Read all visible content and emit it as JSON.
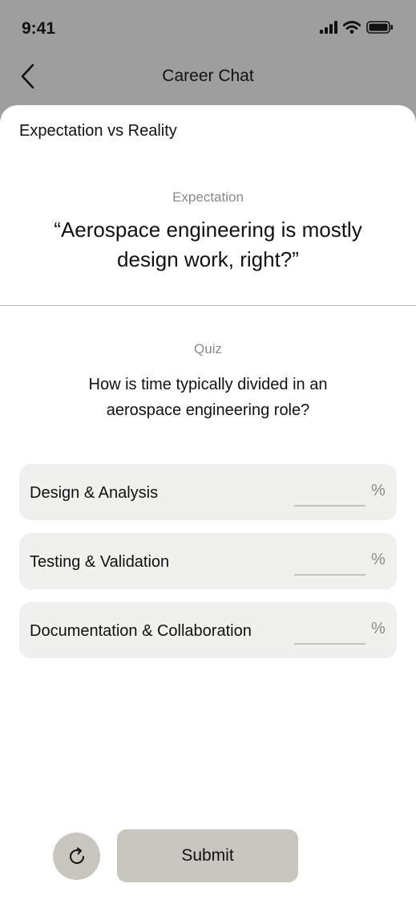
{
  "status_bar": {
    "time": "9:41"
  },
  "nav": {
    "title": "Career Chat"
  },
  "sheet": {
    "header": "Expectation vs Reality",
    "expectation_label": "Expectation",
    "expectation_quote": "“Aerospace engineering is mostly design work, right?”",
    "quiz_label": "Quiz",
    "quiz_question": "How is time typically divided in an aerospace engineering role?",
    "answers": [
      {
        "label": "Design & Analysis",
        "value": "",
        "unit": "%"
      },
      {
        "label": "Testing & Validation",
        "value": "",
        "unit": "%"
      },
      {
        "label": "Documentation & Collaboration",
        "value": "",
        "unit": "%"
      }
    ]
  },
  "actions": {
    "submit_label": "Submit",
    "refresh_icon": "refresh-icon"
  },
  "colors": {
    "status_background": "#9e9e9e",
    "sheet_background": "#ffffff",
    "answer_row_background": "#f0f0ee",
    "button_background": "#c7c6c1",
    "muted_text": "#8a8a8a"
  }
}
